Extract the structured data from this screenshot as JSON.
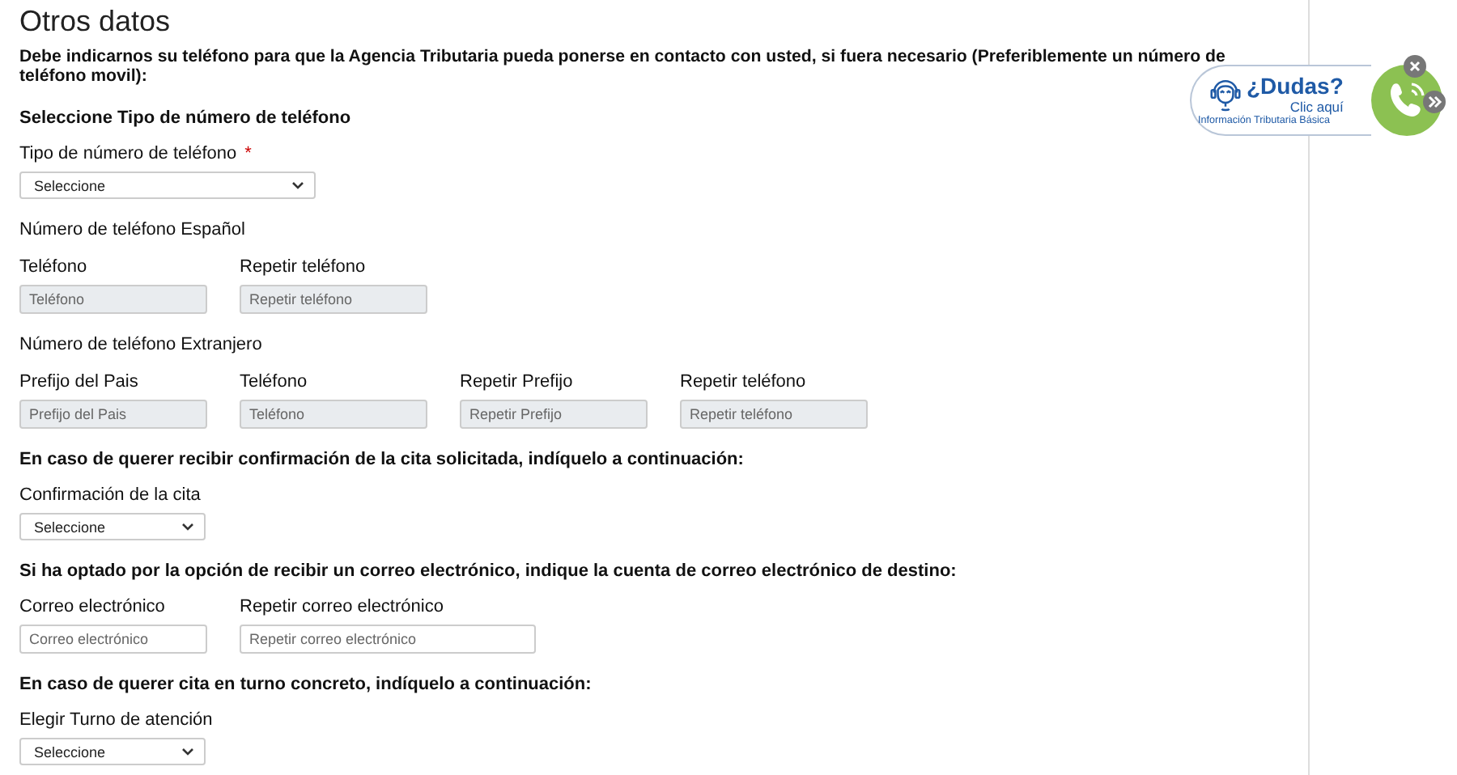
{
  "title": "Otros datos",
  "intro": "Debe indicarnos su teléfono para que la Agencia Tributaria pueda ponerse en contacto con usted, si fuera necesario (Preferiblemente un número de teléfono movil):",
  "blocks": [
    {
      "kind": "note",
      "text": "Seleccione Tipo de número de teléfono"
    },
    {
      "kind": "fields",
      "fields": [
        {
          "label": "Tipo de número de teléfono",
          "required_mark": "*",
          "kind": "long-select",
          "value": "Seleccione",
          "disabled": false
        }
      ]
    },
    {
      "kind": "caption",
      "text": "Número de teléfono Español"
    },
    {
      "kind": "fields",
      "fields": [
        {
          "label": "Teléfono",
          "kind": "input",
          "placeholder": "Teléfono",
          "disabled": true
        },
        {
          "label": "Repetir teléfono",
          "kind": "input",
          "placeholder": "Repetir teléfono",
          "disabled": true
        }
      ]
    },
    {
      "kind": "caption",
      "text": "Número de teléfono Extranjero"
    },
    {
      "kind": "fields",
      "fields": [
        {
          "label": "Prefijo del Pais",
          "kind": "input",
          "placeholder": "Prefijo del Pais",
          "disabled": true
        },
        {
          "label": "Teléfono",
          "kind": "input",
          "placeholder": "Teléfono",
          "disabled": true
        },
        {
          "label": "Repetir Prefijo",
          "kind": "input",
          "placeholder": "Repetir Prefijo",
          "disabled": true
        },
        {
          "label": "Repetir teléfono",
          "kind": "input",
          "placeholder": "Repetir teléfono",
          "disabled": true
        }
      ]
    },
    {
      "kind": "note",
      "text": "En caso de querer recibir confirmación de la cita solicitada, indíquelo a continuación:"
    },
    {
      "kind": "fields",
      "fields": [
        {
          "label": "Confirmación de la cita",
          "kind": "select",
          "value": "Seleccione",
          "disabled": false
        }
      ]
    },
    {
      "kind": "note",
      "text": "Si ha optado por la opción de recibir un correo electrónico, indique la cuenta de correo electrónico de destino:"
    },
    {
      "kind": "fields",
      "fields": [
        {
          "label": "Correo electrónico",
          "kind": "input",
          "placeholder": "Correo electrónico",
          "disabled": false
        },
        {
          "label": "Repetir correo electrónico",
          "kind": "long-input",
          "placeholder": "Repetir correo electrónico",
          "disabled": false
        }
      ]
    },
    {
      "kind": "note",
      "text": "En caso de querer cita en turno concreto, indíquelo a continuación:"
    },
    {
      "kind": "fields",
      "fields": [
        {
          "label": "Elegir Turno de atención",
          "kind": "select",
          "value": "Seleccione",
          "disabled": false
        }
      ]
    }
  ],
  "help": {
    "title": "¿Dudas?",
    "link": "Clic aquí",
    "subtitle": "Información Tributaria Básica"
  }
}
